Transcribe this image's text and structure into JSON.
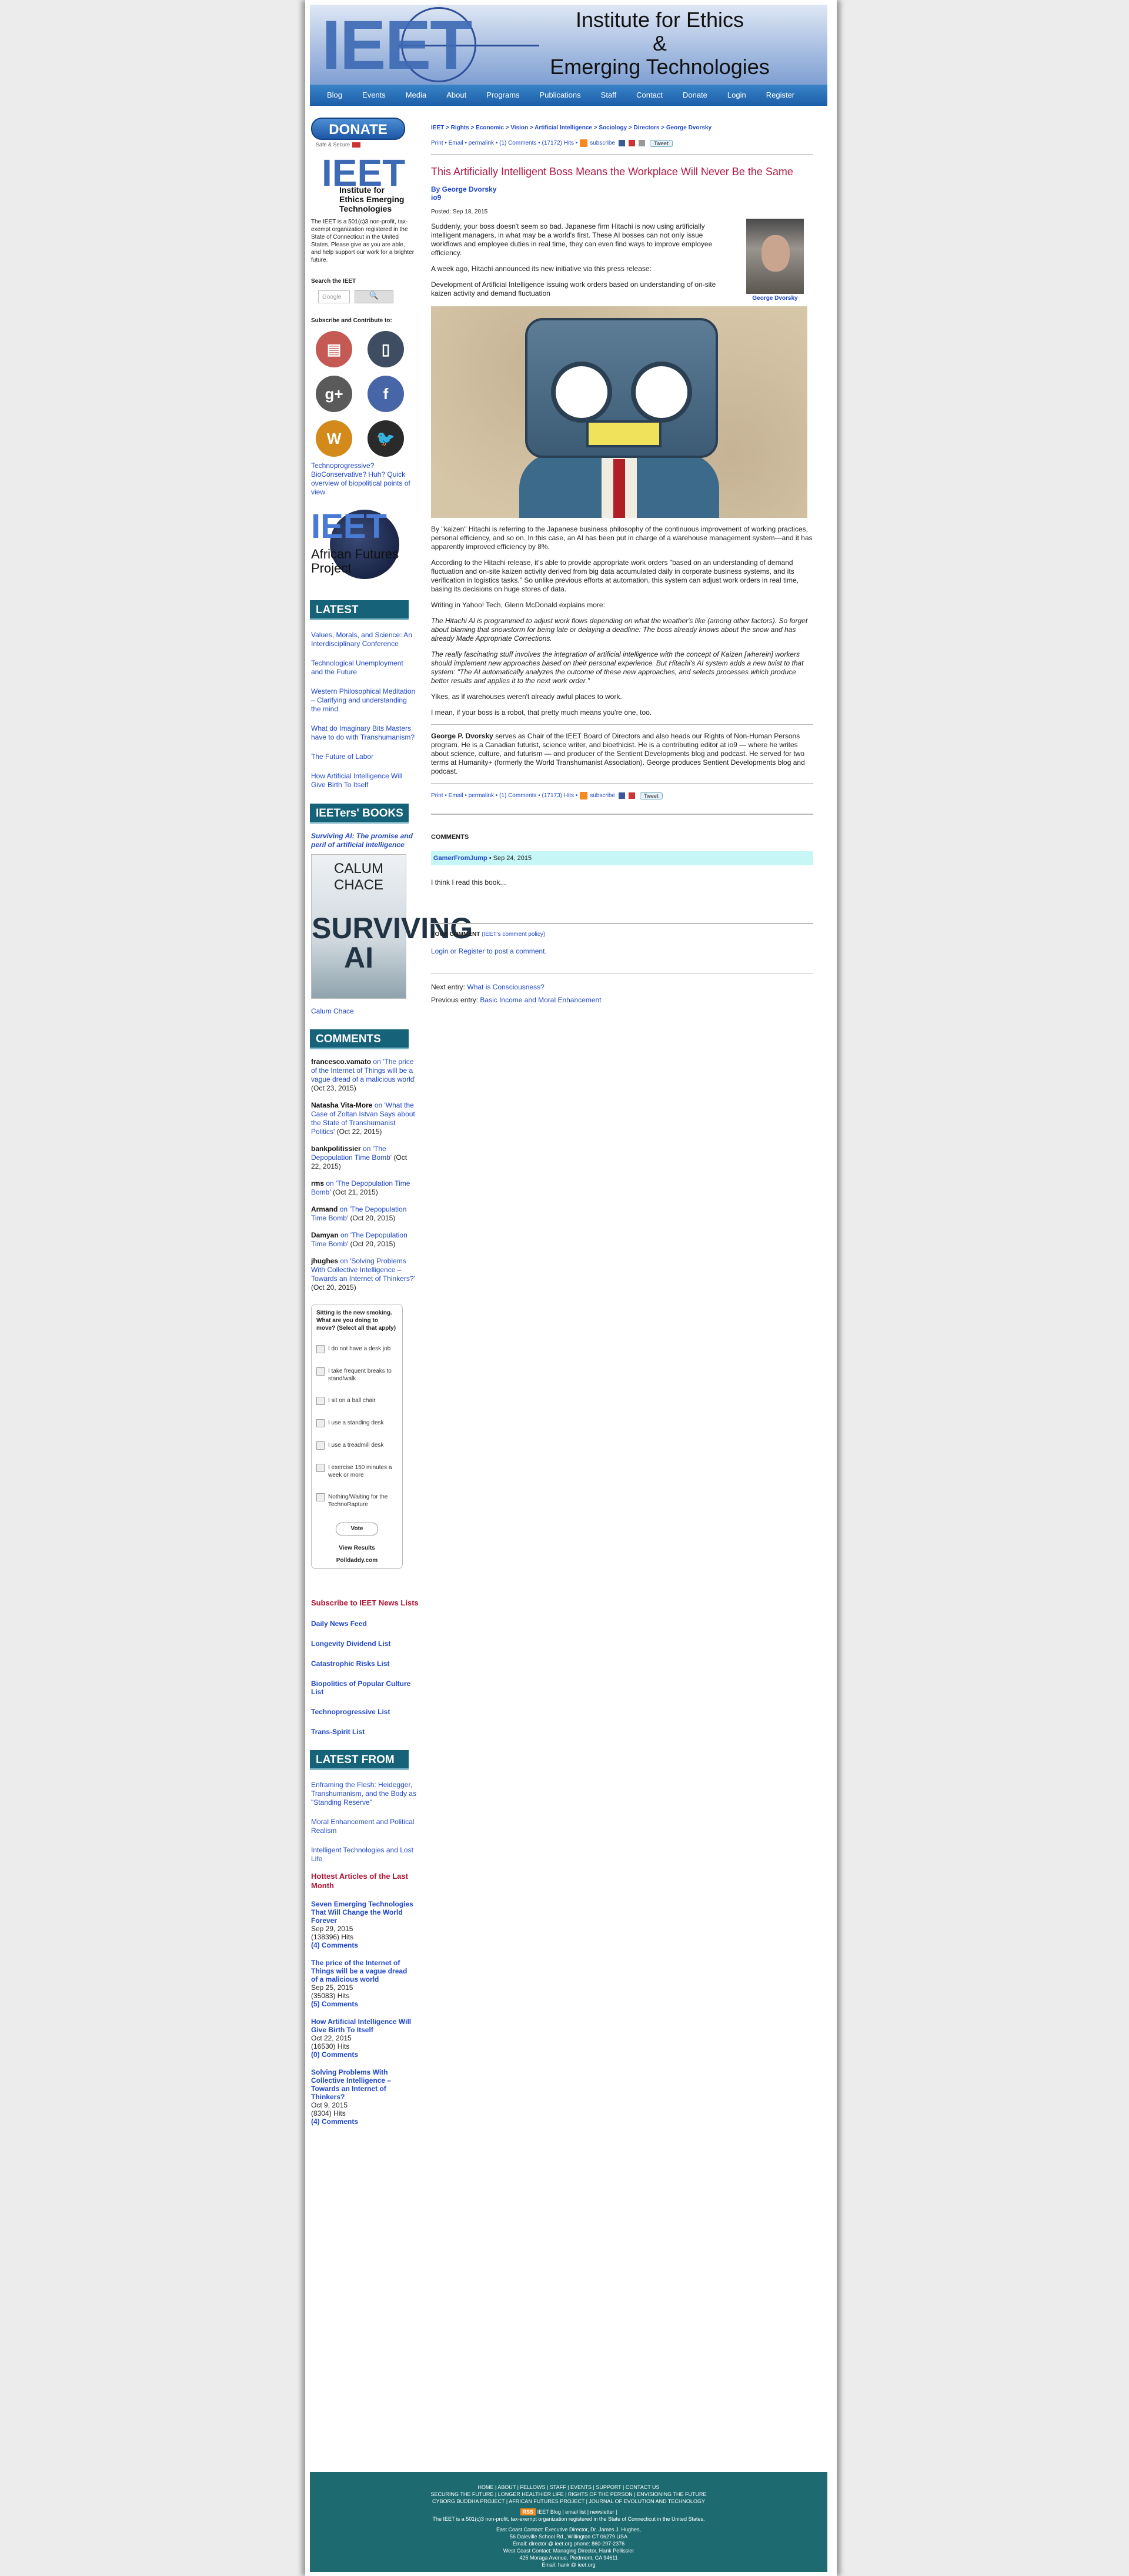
{
  "header": {
    "logo_text": "IEET",
    "title_line1": "Institute for Ethics",
    "title_line2": "&",
    "title_line3": "Emerging Technologies",
    "nav": [
      "Blog",
      "Events",
      "Media",
      "About",
      "Programs",
      "Publications",
      "Staff",
      "Contact",
      "Donate",
      "Login",
      "Register"
    ]
  },
  "sidebar": {
    "donate_label": "DONATE",
    "donate_sub": "Safe & Secure",
    "mini_logo_big": "IEET",
    "mini_logo_small": "Institute for Ethics Emerging Technologies",
    "about": "The IEET is a 501(c)3 non-profit, tax-exempt organization registered in the State of Connecticut in the United States. Please give as you are able, and help support our work for a brighter future.",
    "search_heading": "Search the IEET",
    "search_placeholder": "Google",
    "search_button": "🔍",
    "subscribe_heading": "Subscribe and Contribute to:",
    "techno_link": "Technoprogressive? BioConservative? Huh? Quick overview of biopolitical points of view",
    "afp_word": "IEET",
    "afp_caption": "African Futures Project",
    "latest_heading": "LATEST",
    "latest": [
      "Values, Morals, and Science: An Interdisciplinary Conference",
      "Technological Unemployment and the Future",
      "Western Philosophical Meditation – Clarifying and understanding the mind",
      "What do Imaginary Bits Masters have to do with Transhumanism?",
      "The Future of Labor",
      "How Artificial Intelligence Will Give Birth To Itself"
    ],
    "books_heading": "IEETers' BOOKS",
    "book_caption": "Surviving AI: The promise and peril of artificial intelligence",
    "book_title_top": "CALUM CHACE",
    "book_title_main": "SURVIVING AI",
    "book_author": "Calum Chace",
    "comments_heading": "COMMENTS",
    "comments": [
      {
        "name": "francesco.vamato",
        "text": "on 'The price of the Internet of Things will be a vague dread of a malicious world'",
        "date": "(Oct 23, 2015)"
      },
      {
        "name": "Natasha Vita-More",
        "text": "on 'What the Case of Zoltan Istvan Says about the State of Transhumanist Politics'",
        "date": "(Oct 22, 2015)"
      },
      {
        "name": "bankpolitissier",
        "text": "on 'The Depopulation Time Bomb'",
        "date": "(Oct 22, 2015)"
      },
      {
        "name": "rms",
        "text": "on 'The Depopulation Time Bomb'",
        "date": "(Oct 21, 2015)"
      },
      {
        "name": "Armand",
        "text": "on 'The Depopulation Time Bomb'",
        "date": "(Oct 20, 2015)"
      },
      {
        "name": "Damyan",
        "text": "on 'The Depopulation Time Bomb'",
        "date": "(Oct 20, 2015)"
      },
      {
        "name": "jhughes",
        "text": "on 'Solving Problems With Collective Intelligence – Towards an Internet of Thinkers?'",
        "date": "(Oct 20, 2015)"
      }
    ],
    "poll": {
      "question": "Sitting is the new smoking. What are you doing to move? (Select all that apply)",
      "options": [
        "I do not have a desk job",
        "I take frequent breaks to stand/walk",
        "I sit on a ball chair",
        "I use a standing desk",
        "I use a treadmill desk",
        "I exercise 150 minutes a week or more",
        "Nothing/Waiting for the TechnoRapture"
      ],
      "vote": "Vote",
      "view_results": "View Results",
      "brand": "Polldaddy.com"
    },
    "subscribe_lists_heading": "Subscribe to IEET News Lists",
    "lists": [
      "Daily News Feed",
      "Longevity Dividend List",
      "Catastrophic Risks List",
      "Biopolitics of Popular Culture List",
      "Technoprogressive List",
      "Trans-Spirit List"
    ],
    "jet_heading": "LATEST FROM JET",
    "jet": [
      "Enframing the Flesh: Heidegger, Transhumanism, and the Body as \"Standing Reserve\"",
      "Moral Enhancement and Political Realism",
      "Intelligent Technologies and Lost Life"
    ],
    "hottest_heading": "Hottest Articles of the Last Month",
    "hottest": [
      {
        "title": "Seven Emerging Technologies That Will Change the World Forever",
        "date": "Sep 29, 2015",
        "hits": "(138396) Hits",
        "comments": "(4) Comments"
      },
      {
        "title": "The price of the Internet of Things will be a vague dread of a malicious world",
        "date": "Sep 25, 2015",
        "hits": "(35083) Hits",
        "comments": "(5) Comments"
      },
      {
        "title": "How Artificial Intelligence Will Give Birth To Itself",
        "date": "Oct 22, 2015",
        "hits": "(16530) Hits",
        "comments": "(0) Comments"
      },
      {
        "title": "Solving Problems With Collective Intelligence – Towards an Internet of Thinkers?",
        "date": "Oct 9, 2015",
        "hits": "(8304) Hits",
        "comments": "(4) Comments"
      }
    ]
  },
  "main": {
    "breadcrumb": "IEET > Rights > Economic > Vision > Artificial Intelligence > Sociology > Directors > George Dvorsky",
    "tools_text": "Print • Email • permalink • (1) Comments • (17172) Hits •",
    "subscribe": "subscribe",
    "tweet": "Tweet",
    "title": "This Artificially Intelligent Boss Means the Workplace Will Never Be the Same",
    "author": "By George Dvorsky",
    "source": "io9",
    "posted": "Posted: Sep 18, 2015",
    "author_caption": "George Dvorsky",
    "p1": "Suddenly, your boss doesn't seem so bad. Japanese firm Hitachi is now using artificially intelligent managers, in what may be a world's first. These AI bosses can not only issue workflows and employee duties in real time, they can even find ways to improve employee efficiency.",
    "p2": "A week ago, Hitachi announced its new initiative via this press release:",
    "p3": "Development of Artificial Intelligence issuing work orders based on understanding of on-site kaizen activity and demand fluctuation",
    "p4": "By \"kaizen\" Hitachi is referring to the Japanese business philosophy of the continuous improvement of working practices, personal efficiency, and so on. In this case, an AI has been put in charge of a warehouse management system—and it has apparently improved efficiency by 8%.",
    "p5": "According to the Hitachi release, it's able to provide appropriate work orders \"based on an understanding of demand fluctuation and on-site kaizen activity derived from big data accumulated daily in corporate business systems, and its verification in logistics tasks.\" So unlike previous efforts at automation, this system can adjust work orders in real time, basing its decisions on huge stores of data.",
    "p6": "Writing in Yahoo! Tech, Glenn McDonald explains more:",
    "p7": "The Hitachi AI is programmed to adjust work flows depending on what the weather's like (among other factors). So forget about blaming that snowstorm for being late or delaying a deadline: The boss already knows about the snow and has already Made Appropriate Corrections.",
    "p8": "The really fascinating stuff involves the integration of artificial intelligence with the concept of Kaizen [wherein] workers should implement new approaches based on their personal experience. But Hitachi's AI system adds a new twist to that system: \"The AI automatically analyzes the outcome of these new approaches, and selects processes which produce better results and applies it to the next work order.\"",
    "p9": "Yikes, as if warehouses weren't already awful places to work.",
    "p10": "I mean, if your boss is a robot, that pretty much means you're one, too.",
    "bio_name": "George P. Dvorsky",
    "bio": "serves as Chair of the IEET Board of Directors and also heads our Rights of Non-Human Persons program. He is a Canadian futurist, science writer, and bioethicist. He is a contributing editor at io9 — where he writes about science, culture, and futurism — and producer of the Sentient Developments blog and podcast. He served for two terms at Humanity+ (formerly the World Transhumanist Association). George produces Sentient Developments blog and podcast.",
    "tools_text2": "Print • Email • permalink • (1) Comments • (17173) Hits •",
    "comments_heading": "COMMENTS",
    "comment_author": "GamerFromJump",
    "comment_date": "• Sep 24, 2015",
    "comment_text": "I think I read this book...",
    "your_comment": "YOUR COMMENT",
    "comment_policy": "(IEET's comment policy)",
    "login_text": "Login or Register to post a comment.",
    "next_label": "Next entry:",
    "next_link": "What is Consciousness?",
    "prev_label": "Previous entry:",
    "prev_link": "Basic Income and Moral Enhancement"
  },
  "footer": {
    "line1": "HOME | ABOUT | FELLOWS | STAFF | EVENTS | SUPPORT | CONTACT US",
    "line2": "SECURING THE FUTURE | LONGER HEALTHIER LIFE | RIGHTS OF THE PERSON | ENVISIONING THE FUTURE",
    "line3": "CYBORG BUDDHA PROJECT | AFRICAN FUTURES PROJECT | JOURNAL OF EVOLUTION AND TECHNOLOGY",
    "rss": "RSS",
    "line4": "IEET Blog | email list | newsletter |",
    "line5": "The IEET is a 501(c)3 non-profit, tax-exempt organization registered in the State of Connecticut in the United States.",
    "line6": "East Coast Contact: Executive Director, Dr. James J. Hughes,",
    "line7": "56 Daleville School Rd., Willington CT 06279 USA",
    "line8": "Email: director @ ieet.org   phone: 860-297-2376",
    "line9": "West Coast Contact: Managing Director, Hank Pellissier",
    "line10": "425 Moraga Avenue, Piedmont, CA 94611",
    "line11": "Email: hank @ ieet.org"
  },
  "colors": {
    "accent": "#1f47c8",
    "title": "#b21a44",
    "section": "#156279",
    "footer": "#1d6b70",
    "comment_bar": "#c6f6f6"
  }
}
